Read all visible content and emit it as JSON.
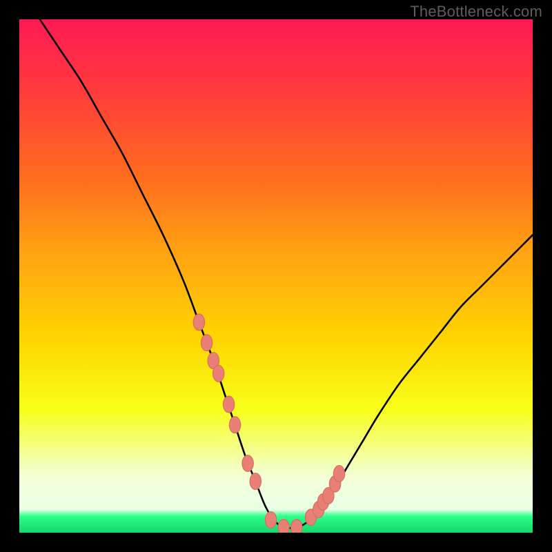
{
  "watermark": "TheBottleneck.com",
  "colors": {
    "frame": "#000000",
    "gradient_stops": [
      {
        "offset": 0.0,
        "color": "#ff1a55"
      },
      {
        "offset": 0.14,
        "color": "#ff3b3b"
      },
      {
        "offset": 0.3,
        "color": "#ff6a1f"
      },
      {
        "offset": 0.46,
        "color": "#ffa512"
      },
      {
        "offset": 0.62,
        "color": "#ffd400"
      },
      {
        "offset": 0.76,
        "color": "#f7ff1a"
      },
      {
        "offset": 0.873,
        "color": "#f3ffbf"
      },
      {
        "offset": 0.897,
        "color": "#f3ffdb"
      },
      {
        "offset": 0.955,
        "color": "#e8ffe3"
      },
      {
        "offset": 0.968,
        "color": "#2dff8b"
      },
      {
        "offset": 1.0,
        "color": "#17d66b"
      }
    ],
    "curve": "#000000",
    "marker_fill": "#e98076",
    "marker_stroke": "#d46a60"
  },
  "chart_data": {
    "type": "line",
    "title": "",
    "xlabel": "",
    "ylabel": "",
    "xlim": [
      0,
      100
    ],
    "ylim": [
      0,
      100
    ],
    "grid": false,
    "legend": false,
    "series": [
      {
        "name": "bottleneck-curve",
        "x": [
          4,
          8,
          12,
          16,
          20,
          24,
          28,
          32,
          35,
          38,
          40,
          42,
          44,
          46,
          48,
          50,
          52,
          54,
          56,
          58,
          61,
          64,
          67,
          70,
          74,
          78,
          82,
          86,
          90,
          94,
          98,
          100
        ],
        "y": [
          100,
          94,
          88,
          81,
          74,
          66,
          58,
          49,
          41,
          33,
          27,
          21,
          15,
          10,
          5,
          2,
          1,
          1,
          2,
          4,
          8,
          13,
          18,
          23,
          29,
          34,
          39,
          44,
          48,
          52,
          56,
          58
        ]
      }
    ],
    "markers": {
      "name": "highlight-points",
      "x": [
        35.0,
        36.5,
        37.8,
        38.8,
        40.8,
        42.0,
        44.5,
        46.0,
        49.0,
        51.5,
        54.0,
        56.8,
        58.3,
        59.2,
        60.2,
        61.5,
        62.3
      ],
      "y": [
        41.0,
        37.0,
        33.5,
        31.0,
        25.0,
        21.0,
        13.5,
        10.0,
        2.5,
        1.0,
        1.0,
        3.0,
        4.5,
        6.0,
        7.2,
        9.5,
        11.5
      ],
      "rx": 1.1,
      "ry": 1.6
    }
  }
}
